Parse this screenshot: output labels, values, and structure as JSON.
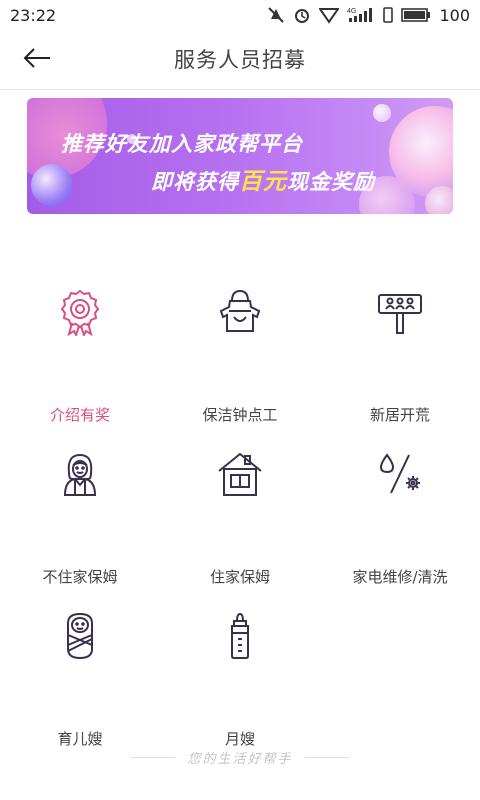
{
  "status_bar": {
    "time": "23:22",
    "battery": "100",
    "network": "4G",
    "icons": [
      "mute-icon",
      "alarm-icon",
      "wifi-icon",
      "signal-icon",
      "sim-icon",
      "battery-icon"
    ]
  },
  "nav": {
    "title": "服务人员招募",
    "back_icon": "arrow-left-icon"
  },
  "banner": {
    "line1": "推荐好友加入家政帮平台",
    "line2_prefix": "即将获得",
    "line2_highlight": "百元",
    "line2_suffix": "现金奖励",
    "colors": {
      "background": "#b36cf0",
      "highlight": "#ffe14a"
    }
  },
  "services": [
    {
      "label": "介绍有奖",
      "icon": "award-badge-icon",
      "active": true
    },
    {
      "label": "保洁钟点工",
      "icon": "apron-icon",
      "active": false
    },
    {
      "label": "新居开荒",
      "icon": "signboard-icon",
      "active": false
    },
    {
      "label": "不住家保姆",
      "icon": "nanny-icon",
      "active": false
    },
    {
      "label": "住家保姆",
      "icon": "house-icon",
      "active": false
    },
    {
      "label": "家电维修/清洗",
      "icon": "repair-icon",
      "active": false
    },
    {
      "label": "育儿嫂",
      "icon": "baby-icon",
      "active": false
    },
    {
      "label": "月嫂",
      "icon": "baby-bottle-icon",
      "active": false
    }
  ],
  "footer": {
    "slogan": "您的生活好帮手"
  },
  "colors": {
    "accent": "#d8507f",
    "icon_stroke": "#3a2f4d",
    "text": "#444444"
  }
}
